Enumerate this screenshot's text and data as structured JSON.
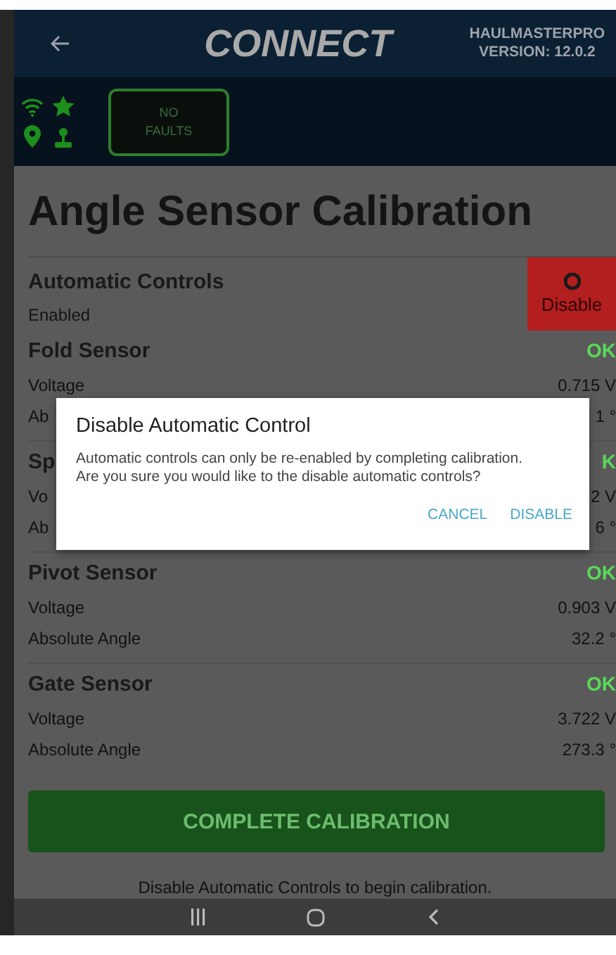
{
  "header": {
    "logo": "CONNECT",
    "version_lines": [
      "HAULMASTERPRO",
      "VERSION: 12.0.2"
    ]
  },
  "status_bar": {
    "faults": "NO FAULTS"
  },
  "title": "Angle Sensor Calibration",
  "automatic_controls": {
    "name": "Automatic Controls",
    "state": "Enabled",
    "button": "Disable"
  },
  "sensors": [
    {
      "name": "Fold Sensor",
      "status": "OK",
      "readings": [
        {
          "label": "Voltage",
          "value": "0.715 V"
        },
        {
          "label": "Ab",
          "value": "1 °"
        }
      ]
    },
    {
      "name": "Sp",
      "status": "K",
      "readings": [
        {
          "label": "Vo",
          "value": "2 V"
        },
        {
          "label": "Ab",
          "value": "6 °"
        }
      ]
    },
    {
      "name": "Pivot Sensor",
      "status": "OK",
      "readings": [
        {
          "label": "Voltage",
          "value": "0.903 V"
        },
        {
          "label": "Absolute Angle",
          "value": "32.2 °"
        }
      ]
    },
    {
      "name": "Gate Sensor",
      "status": "OK",
      "readings": [
        {
          "label": "Voltage",
          "value": "3.722 V"
        },
        {
          "label": "Absolute Angle",
          "value": "273.3 °"
        }
      ]
    }
  ],
  "complete_button": {
    "label": "COMPLETE CALIBRATION",
    "disabled": true
  },
  "hint": "Disable Automatic Controls to begin calibration.",
  "dialog": {
    "title": "Disable Automatic Control",
    "message": "Automatic controls can only be re-enabled by completing calibration.\nAre you sure you would like to the disable automatic controls?",
    "buttons": [
      {
        "label": "CANCEL"
      },
      {
        "label": "DISABLE"
      }
    ]
  }
}
